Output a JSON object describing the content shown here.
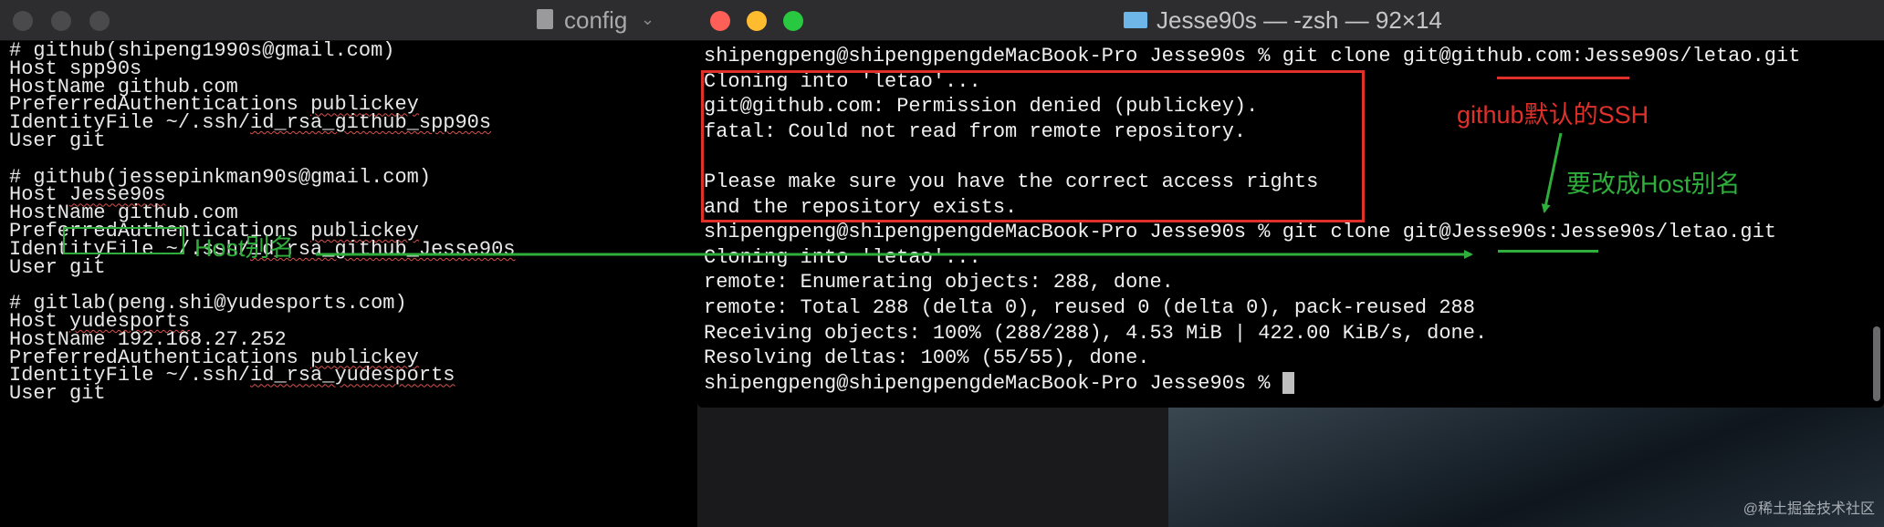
{
  "editor": {
    "title": "config",
    "lines": [
      {
        "parts": [
          "# github(shipeng1990s@gmail.com)"
        ]
      },
      {
        "parts": [
          "Host spp90s"
        ]
      },
      {
        "parts": [
          "HostName github.com"
        ]
      },
      {
        "parts": [
          "PreferredAuthentications ",
          "publickey"
        ]
      },
      {
        "parts": [
          "IdentityFile ~/.ssh/",
          "id_rsa_github_spp90s"
        ]
      },
      {
        "parts": [
          "User git"
        ]
      },
      {
        "parts": [
          ""
        ]
      },
      {
        "parts": [
          "# github(jessepinkman90s@gmail.com)"
        ]
      },
      {
        "parts": [
          "Host ",
          "Jesse90s"
        ]
      },
      {
        "parts": [
          "HostName github.com"
        ]
      },
      {
        "parts": [
          "PreferredAuthentications ",
          "publickey"
        ]
      },
      {
        "parts": [
          "IdentityFile ~/.ssh/",
          "id_rsa_github_Jesse90s"
        ]
      },
      {
        "parts": [
          "User git"
        ]
      },
      {
        "parts": [
          ""
        ]
      },
      {
        "parts": [
          "# gitlab(peng.shi@yudesports.com)"
        ]
      },
      {
        "parts": [
          "Host ",
          "yudesports"
        ]
      },
      {
        "parts": [
          "HostName 192.168.27.252"
        ]
      },
      {
        "parts": [
          "PreferredAuthentications ",
          "publickey"
        ]
      },
      {
        "parts": [
          "IdentityFile ~/.ssh/",
          "id_rsa_yudesports"
        ]
      },
      {
        "parts": [
          "User git"
        ]
      }
    ]
  },
  "terminal": {
    "title": "Jesse90s — -zsh — 92×14",
    "lines": [
      "shipengpeng@shipengpengdeMacBook-Pro Jesse90s % git clone git@github.com:Jesse90s/letao.git",
      "Cloning into 'letao'...",
      "git@github.com: Permission denied (publickey).",
      "fatal: Could not read from remote repository.",
      "",
      "Please make sure you have the correct access rights",
      "and the repository exists.",
      "shipengpeng@shipengpengdeMacBook-Pro Jesse90s % git clone git@Jesse90s:Jesse90s/letao.git",
      "Cloning into 'letao'...",
      "remote: Enumerating objects: 288, done.",
      "remote: Total 288 (delta 0), reused 0 (delta 0), pack-reused 288",
      "Receiving objects: 100% (288/288), 4.53 MiB | 422.00 KiB/s, done.",
      "Resolving deltas: 100% (55/55), done.",
      "shipengpeng@shipengpengdeMacBook-Pro Jesse90s % "
    ]
  },
  "annotations": {
    "host_alias": "Host别名",
    "github_default_ssh": "github默认的SSH",
    "change_to_alias": "要改成Host别名"
  },
  "watermark": "@稀土掘金技术社区",
  "colors": {
    "red": "#e0302a",
    "green": "#2fae3c"
  }
}
